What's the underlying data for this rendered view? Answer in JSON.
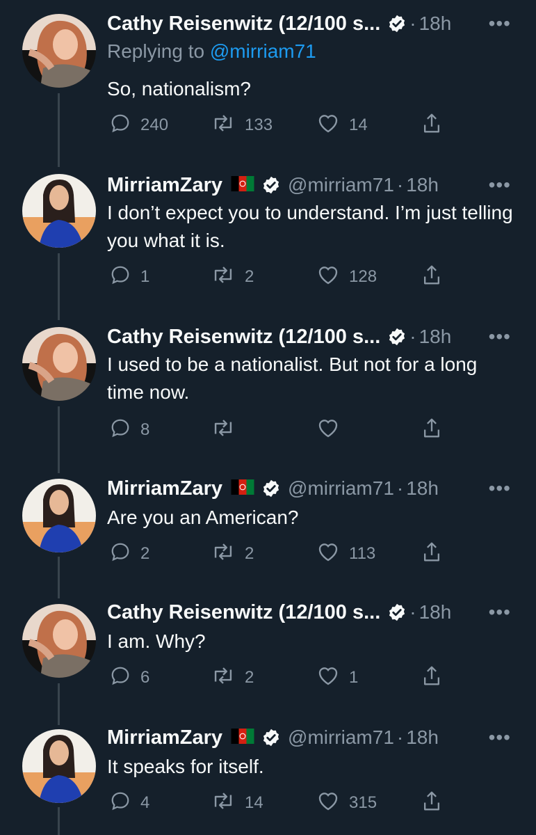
{
  "tweets": [
    {
      "name": "Cathy Reisenwitz (12/100 s...",
      "handle": "",
      "time": "18h",
      "replying_label": "Replying to",
      "replying_to": "@mirriam71",
      "text": "So, nationalism?",
      "replies": "240",
      "retweets": "133",
      "likes": "14"
    },
    {
      "name": "MirriamZary",
      "handle": "@mirriam71",
      "time": "18h",
      "text": "I don’t expect you to understand. I’m just telling you what it is.",
      "replies": "1",
      "retweets": "2",
      "likes": "128"
    },
    {
      "name": "Cathy Reisenwitz (12/100 s...",
      "handle": "",
      "time": "18h",
      "text": "I used to be a nationalist. But not for a long time now.",
      "replies": "8",
      "retweets": "",
      "likes": ""
    },
    {
      "name": "MirriamZary",
      "handle": "@mirriam71",
      "time": "18h",
      "text": "Are you an American?",
      "replies": "2",
      "retweets": "2",
      "likes": "113"
    },
    {
      "name": "Cathy Reisenwitz (12/100 s...",
      "handle": "",
      "time": "18h",
      "text": "I am. Why?",
      "replies": "6",
      "retweets": "2",
      "likes": "1"
    },
    {
      "name": "MirriamZary",
      "handle": "@mirriam71",
      "time": "18h",
      "text": "It speaks for itself.",
      "replies": "4",
      "retweets": "14",
      "likes": "315"
    }
  ],
  "ui": {
    "separator": "·",
    "more": "•••"
  },
  "icons": {
    "verified": "verified-badge-icon",
    "flag": "afghanistan-flag-icon",
    "reply": "reply-icon",
    "retweet": "retweet-icon",
    "like": "heart-icon",
    "share": "share-icon",
    "more": "more-icon"
  },
  "colors": {
    "background": "#15202b",
    "text": "#f7f9f9",
    "muted": "#8b98a5",
    "link": "#1d9bf0",
    "thread_line": "#38444d"
  }
}
